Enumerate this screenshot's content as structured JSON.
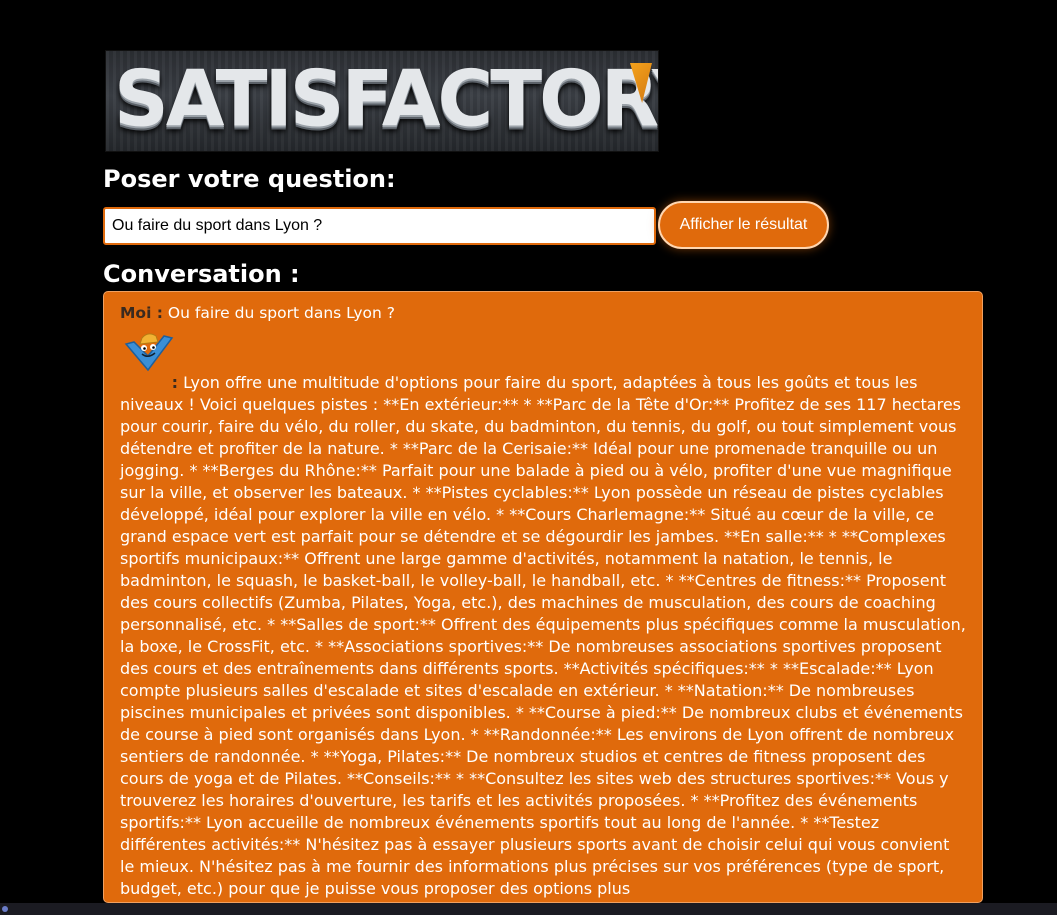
{
  "logo": {
    "text": "SATISFACTORY"
  },
  "question": {
    "heading": "Poser votre question:",
    "input_value": "Ou faire du sport dans Lyon ?",
    "button_label": "Afficher le résultat"
  },
  "conversation": {
    "heading": "Conversation :",
    "user_speaker": "Moi :",
    "user_message": "Ou faire du sport dans Lyon ?",
    "bot_avatar_icon": "ficsit-mascot-icon",
    "bot_colon": ":",
    "bot_message": "Lyon offre une multitude d'options pour faire du sport, adaptées à tous les goûts et tous les niveaux ! Voici quelques pistes : **En extérieur:** * **Parc de la Tête d'Or:** Profitez de ses 117 hectares pour courir, faire du vélo, du roller, du skate, du badminton, du tennis, du golf, ou tout simplement vous détendre et profiter de la nature. * **Parc de la Cerisaie:** Idéal pour une promenade tranquille ou un jogging. * **Berges du Rhône:** Parfait pour une balade à pied ou à vélo, profiter d'une vue magnifique sur la ville, et observer les bateaux. * **Pistes cyclables:** Lyon possède un réseau de pistes cyclables développé, idéal pour explorer la ville en vélo. * **Cours Charlemagne:** Situé au cœur de la ville, ce grand espace vert est parfait pour se détendre et se dégourdir les jambes. **En salle:** * **Complexes sportifs municipaux:** Offrent une large gamme d'activités, notamment la natation, le tennis, le badminton, le squash, le basket-ball, le volley-ball, le handball, etc. * **Centres de fitness:** Proposent des cours collectifs (Zumba, Pilates, Yoga, etc.), des machines de musculation, des cours de coaching personnalisé, etc. * **Salles de sport:** Offrent des équipements plus spécifiques comme la musculation, la boxe, le CrossFit, etc. * **Associations sportives:** De nombreuses associations sportives proposent des cours et des entraînements dans différents sports. **Activités spécifiques:** * **Escalade:** Lyon compte plusieurs salles d'escalade et sites d'escalade en extérieur. * **Natation:** De nombreuses piscines municipales et privées sont disponibles. * **Course à pied:** De nombreux clubs et événements de course à pied sont organisés dans Lyon. * **Randonnée:** Les environs de Lyon offrent de nombreux sentiers de randonnée. * **Yoga, Pilates:** De nombreux studios et centres de fitness proposent des cours de yoga et de Pilates. **Conseils:** * **Consultez les sites web des structures sportives:** Vous y trouverez les horaires d'ouverture, les tarifs et les activités proposées. * **Profitez des événements sportifs:** Lyon accueille de nombreux événements sportifs tout au long de l'année. * **Testez différentes activités:** N'hésitez pas à essayer plusieurs sports avant de choisir celui qui vous convient le mieux. N'hésitez pas à me fournir des informations plus précises sur vos préférences (type de sport, budget, etc.) pour que je puisse vous proposer des options plus"
  },
  "colors": {
    "accent": "#e06a0c",
    "background": "#000000",
    "text": "#ffffff"
  }
}
